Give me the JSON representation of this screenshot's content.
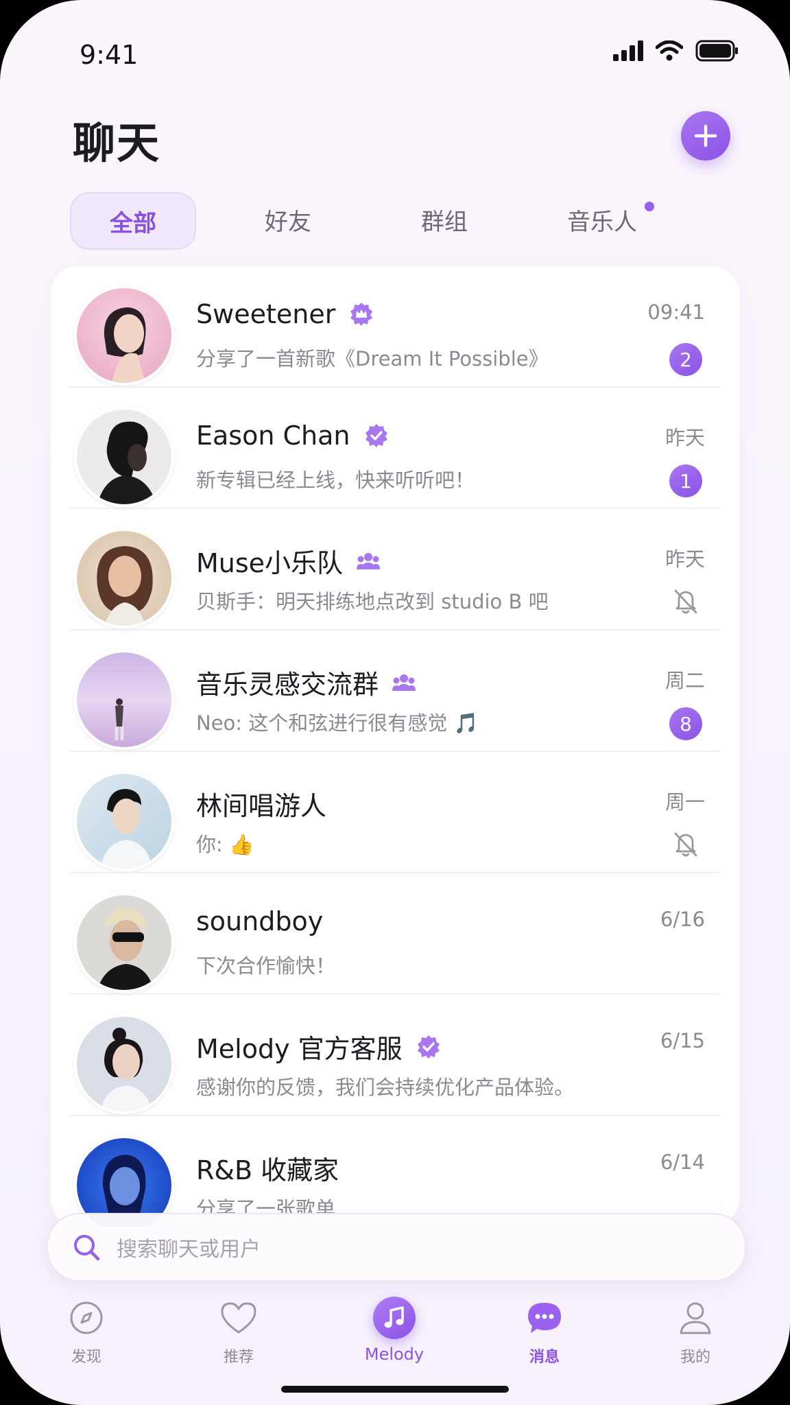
{
  "status_bar": {
    "time": "9:41"
  },
  "header": {
    "title": "聊天"
  },
  "tabs": [
    {
      "label": "全部"
    },
    {
      "label": "好友"
    },
    {
      "label": "群组"
    },
    {
      "label": "音乐人"
    }
  ],
  "chats": [
    {
      "name": "Sweetener",
      "preview": "分享了一首新歌《Dream It Possible》",
      "time": "09:41",
      "badge": "2",
      "name_icon": "crown-badge-icon"
    },
    {
      "name": "Eason Chan",
      "preview": "新专辑已经上线，快来听听吧！",
      "time": "昨天",
      "badge": "1",
      "name_icon": "verified-icon"
    },
    {
      "name": "Muse小乐队",
      "preview": "贝斯手：明天排练地点改到 studio B 吧",
      "time": "昨天",
      "status": "muted",
      "name_icon": "group-icon"
    },
    {
      "name": "音乐灵感交流群",
      "preview": "Neo: 这个和弦进行很有感觉 🎵",
      "time": "周二",
      "badge": "8",
      "name_icon": "group-icon"
    },
    {
      "name": "林间唱游人",
      "preview": "你: 👍",
      "time": "周一",
      "status": "muted"
    },
    {
      "name": "soundboy",
      "preview": "下次合作愉快！",
      "time": "6/16"
    },
    {
      "name": "Melody 官方客服",
      "preview": "感谢你的反馈，我们会持续优化产品体验。",
      "time": "6/15",
      "name_icon": "verified-icon"
    },
    {
      "name": "R&B 收藏家",
      "preview": "分享了一张歌单",
      "time": "6/14"
    }
  ],
  "search": {
    "placeholder": "搜索聊天或用户"
  },
  "bottom_nav": [
    {
      "label": "发现",
      "icon": "compass-icon"
    },
    {
      "label": "推荐",
      "icon": "heart-icon"
    },
    {
      "label": "Melody",
      "icon": "music-note-icon"
    },
    {
      "label": "消息",
      "icon": "chat-bubble-icon",
      "active": true
    },
    {
      "label": "我的",
      "icon": "user-icon"
    }
  ],
  "colors": {
    "accent": "#8a52e6",
    "accent_light": "#a877f0",
    "tab_active_bg": "#f1e8fc",
    "muted_text": "#8a8a92"
  }
}
